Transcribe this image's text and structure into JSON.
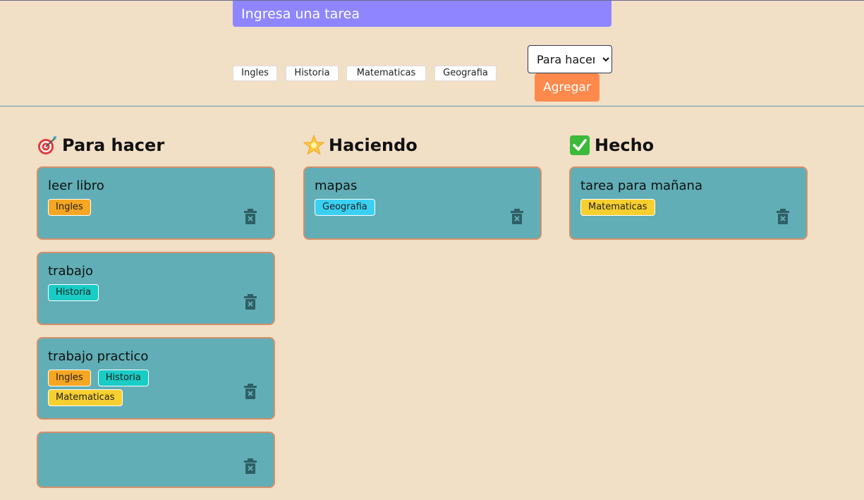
{
  "form": {
    "placeholder": "Ingresa una tarea",
    "tag_options": [
      "Ingles",
      "Historia",
      "Matematicas",
      "Geografia"
    ],
    "status_selected": "Para hacer",
    "add_label": "Agregar"
  },
  "columns": [
    {
      "title": "Para hacer",
      "icon": "target-icon",
      "cards": [
        {
          "title": "leer libro",
          "tags": [
            "Ingles"
          ]
        },
        {
          "title": "trabajo",
          "tags": [
            "Historia"
          ]
        },
        {
          "title": "trabajo practico",
          "tags": [
            "Ingles",
            "Historia",
            "Matematicas"
          ]
        },
        {
          "title": "",
          "tags": []
        }
      ]
    },
    {
      "title": "Haciendo",
      "icon": "star-icon",
      "cards": [
        {
          "title": "mapas",
          "tags": [
            "Geografia"
          ]
        }
      ]
    },
    {
      "title": "Hecho",
      "icon": "check-icon",
      "cards": [
        {
          "title": "tarea para mañana",
          "tags": [
            "Matematicas"
          ]
        }
      ]
    }
  ],
  "colors": {
    "background": "#f1dfc6",
    "input": "#8f86ff",
    "add_button": "#fd8a4c",
    "card": "#61aeb6",
    "card_border": "#d4906a",
    "tag_ingles": "#f5a623",
    "tag_historia": "#19ccc5",
    "tag_geografia": "#3ad0f2",
    "tag_matematicas": "#f7cf2f"
  }
}
